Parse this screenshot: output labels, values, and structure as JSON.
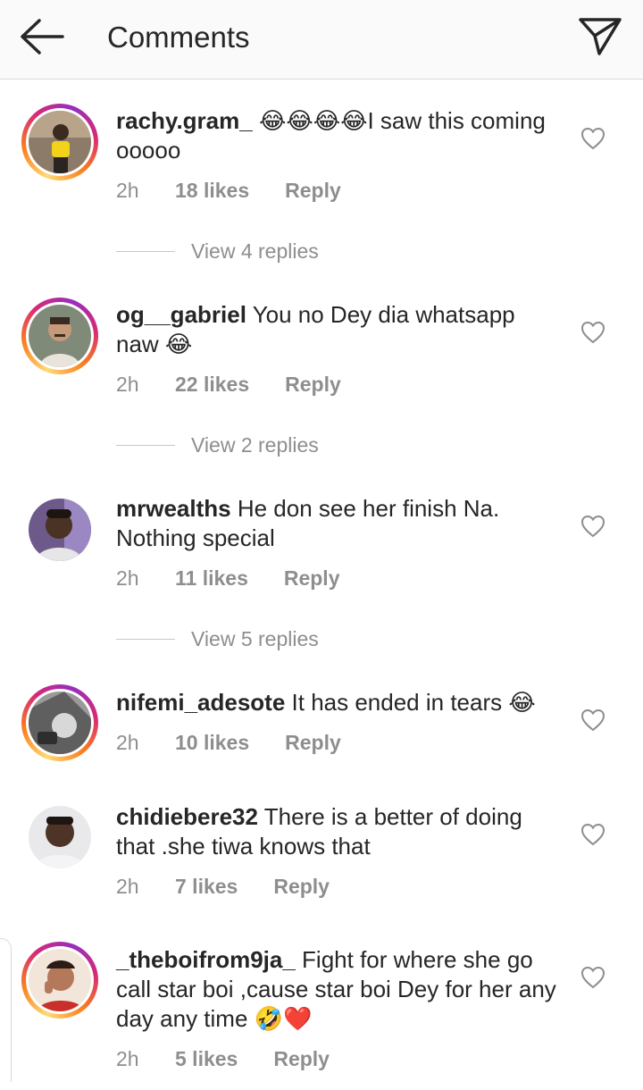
{
  "header": {
    "title": "Comments",
    "back_icon": "arrow-left-icon",
    "send_icon": "paper-plane-icon"
  },
  "comments": [
    {
      "username": "rachy.gram_",
      "text": " 😂😂😂😂I saw this coming ooooo",
      "time": "2h",
      "likes": "18 likes",
      "reply": "Reply",
      "view_replies": "View 4 replies",
      "story_ring": true
    },
    {
      "username": "og__gabriel",
      "text": " You no Dey dia whatsapp naw 😂",
      "time": "2h",
      "likes": "22 likes",
      "reply": "Reply",
      "view_replies": "View 2 replies",
      "story_ring": true
    },
    {
      "username": "mrwealths",
      "text": " He don see her finish Na. Nothing special",
      "time": "2h",
      "likes": "11 likes",
      "reply": "Reply",
      "view_replies": "View 5 replies",
      "story_ring": false
    },
    {
      "username": "nifemi_adesote",
      "text": " It has ended in tears 😂",
      "time": "2h",
      "likes": "10 likes",
      "reply": "Reply",
      "story_ring": true
    },
    {
      "username": "chidiebere32",
      "text": " There is a better of doing that .she tiwa knows that",
      "time": "2h",
      "likes": "7 likes",
      "reply": "Reply",
      "story_ring": false
    },
    {
      "username": "_theboifrom9ja_",
      "text": " Fight for where she go call star boi ,cause star boi Dey for her any day any time 🤣❤️",
      "time": "2h",
      "likes": "5 likes",
      "reply": "Reply",
      "story_ring": true
    }
  ],
  "colors": {
    "text": "#262626",
    "meta": "#8e8e8e",
    "ring_start": "#feda75",
    "ring_end": "#962fbf"
  },
  "icons": {
    "heart": "heart-outline-icon"
  }
}
